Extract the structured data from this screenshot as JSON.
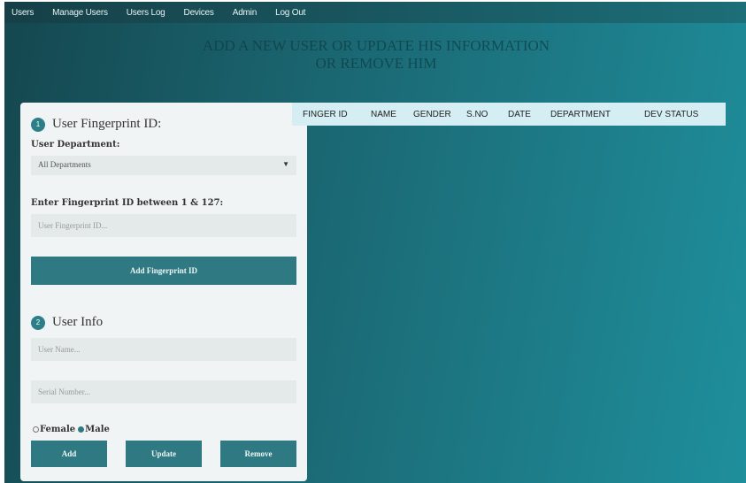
{
  "nav": {
    "items": [
      "Users",
      "Manage Users",
      "Users Log",
      "Devices",
      "Admin",
      "Log Out"
    ]
  },
  "page_title": {
    "line1": "ADD A NEW USER OR UPDATE HIS INFORMATION",
    "line2": "OR REMOVE HIM"
  },
  "fingerprint_section": {
    "step_number": "1",
    "heading": "User Fingerprint ID:",
    "department_label": "User Department:",
    "department_selected": "All Departments",
    "fingerprint_label": "Enter Fingerprint ID between 1 & 127:",
    "fingerprint_placeholder": "User Fingerprint ID...",
    "add_fingerprint_button": "Add Fingerprint ID"
  },
  "user_info_section": {
    "step_number": "2",
    "heading": "User Info",
    "name_placeholder": "User Name...",
    "serial_placeholder": "Serial Number...",
    "gender_female": "Female",
    "gender_male": "Male",
    "gender_selected": "Male",
    "add_button": "Add",
    "update_button": "Update",
    "remove_button": "Remove"
  },
  "table": {
    "columns": [
      "FINGER ID",
      "NAME",
      "GENDER",
      "S.NO",
      "DATE",
      "DEPARTMENT",
      "DEV STATUS"
    ],
    "rows": []
  },
  "colors": {
    "accent": "#2f7a82",
    "table_header_bg": "#d5eef3",
    "panel_bg": "#f1f4f5"
  }
}
